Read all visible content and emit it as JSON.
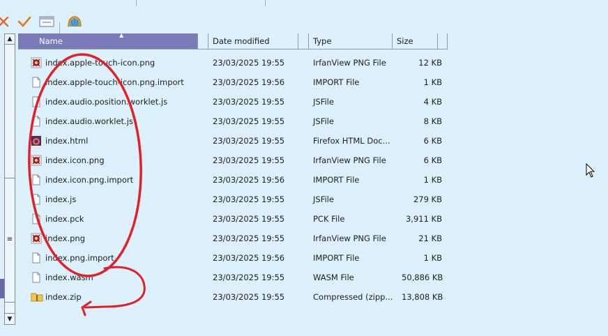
{
  "columns": {
    "name": "Name",
    "date": "Date modified",
    "type": "Type",
    "size": "Size"
  },
  "files": [
    {
      "name": "index.apple-touch-icon.png",
      "date": "23/03/2025 19:55",
      "type": "IrfanView PNG File",
      "size": "12 KB",
      "icon": "irfanview-png-icon"
    },
    {
      "name": "index.apple-touch-icon.png.import",
      "date": "23/03/2025 19:56",
      "type": "IMPORT File",
      "size": "1 KB",
      "icon": "generic-file-icon"
    },
    {
      "name": "index.audio.position.worklet.js",
      "date": "23/03/2025 19:55",
      "type": "JSFile",
      "size": "4 KB",
      "icon": "generic-file-icon"
    },
    {
      "name": "index.audio.worklet.js",
      "date": "23/03/2025 19:55",
      "type": "JSFile",
      "size": "8 KB",
      "icon": "generic-file-icon"
    },
    {
      "name": "index.html",
      "date": "23/03/2025 19:55",
      "type": "Firefox HTML Doc...",
      "size": "6 KB",
      "icon": "firefox-html-icon"
    },
    {
      "name": "index.icon.png",
      "date": "23/03/2025 19:55",
      "type": "IrfanView PNG File",
      "size": "6 KB",
      "icon": "irfanview-png-icon"
    },
    {
      "name": "index.icon.png.import",
      "date": "23/03/2025 19:56",
      "type": "IMPORT File",
      "size": "1 KB",
      "icon": "generic-file-icon"
    },
    {
      "name": "index.js",
      "date": "23/03/2025 19:55",
      "type": "JSFile",
      "size": "279 KB",
      "icon": "generic-file-icon"
    },
    {
      "name": "index.pck",
      "date": "23/03/2025 19:55",
      "type": "PCK File",
      "size": "3,911 KB",
      "icon": "generic-file-icon"
    },
    {
      "name": "index.png",
      "date": "23/03/2025 19:55",
      "type": "IrfanView PNG File",
      "size": "21 KB",
      "icon": "irfanview-png-icon"
    },
    {
      "name": "index.png.import",
      "date": "23/03/2025 19:56",
      "type": "IMPORT File",
      "size": "1 KB",
      "icon": "generic-file-icon"
    },
    {
      "name": "index.wasm",
      "date": "23/03/2025 19:55",
      "type": "WASM File",
      "size": "50,886 KB",
      "icon": "generic-file-icon"
    },
    {
      "name": "index.zip",
      "date": "23/03/2025 19:55",
      "type": "Compressed (zipp...",
      "size": "13,808 KB",
      "icon": "zip-folder-icon"
    }
  ],
  "colors": {
    "accent": "#7b7ab8",
    "background": "#dcf1fb",
    "annotation": "#e0202a"
  }
}
